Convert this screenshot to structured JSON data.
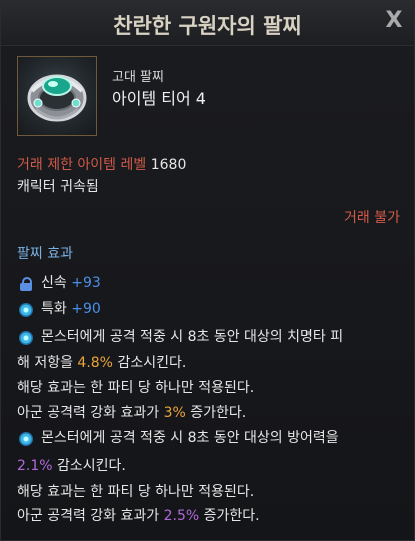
{
  "window": {
    "title": "찬란한 구원자의 팔찌",
    "close_label": "X"
  },
  "item": {
    "grade": "고대 팔찌",
    "tier": "아이템 티어 4"
  },
  "requirements": {
    "level_label": "거래 제한 아이템 레벨",
    "level_value": "1680",
    "binding": "캐릭터 귀속됨",
    "trade_status": "거래 불가"
  },
  "effects": {
    "header": "팔찌 효과",
    "stats": [
      {
        "icon": "lock-icon",
        "name": "신속",
        "value": "+93"
      },
      {
        "icon": "gem-icon",
        "name": "특화",
        "value": "+90"
      }
    ],
    "special": [
      {
        "icon": "gem-icon",
        "line1": "몬스터에게 공격 적중 시 8초 동안 대상의 치명타 피",
        "line2_pre": "해 저항을 ",
        "line2_value": "4.8%",
        "line2_post": " 감소시킨다.",
        "line3": "해당 효과는 한 파티 당 하나만 적용된다.",
        "line4_pre": "아군 공격력 강화 효과가 ",
        "line4_value": "3%",
        "line4_post": " 증가한다."
      },
      {
        "icon": "gem-icon",
        "line1": "몬스터에게 공격 적중 시 8초 동안 대상의 방어력을",
        "line2_pre": "",
        "line2_value": "2.1%",
        "line2_post": " 감소시킨다.",
        "line3": "해당 효과는 한 파티 당 하나만 적용된다.",
        "line4_pre": "아군 공격력 강화 효과가 ",
        "line4_value": "2.5%",
        "line4_post": " 증가한다."
      }
    ]
  },
  "colors": {
    "red_label": "#d05a48",
    "blue_header": "#7ab0e0",
    "stat_value": "#4a90e8",
    "highlight_orange": "#e9a43a",
    "highlight_purple": "#b06ad8"
  }
}
